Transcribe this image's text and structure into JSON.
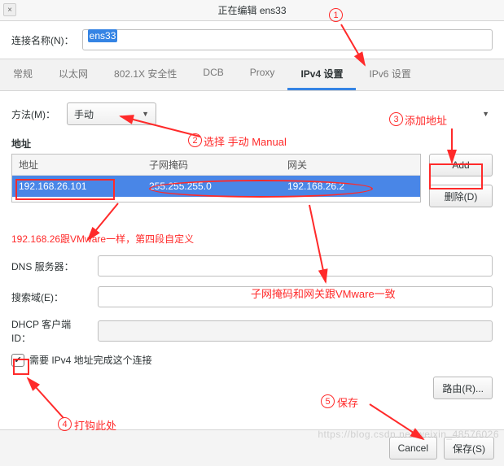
{
  "title": "正在编辑 ens33",
  "close_glyph": "×",
  "name_label": "连接名称(N)：",
  "name_value": "ens33",
  "tabs": {
    "t0": "常规",
    "t1": "以太网",
    "t2": "802.1X 安全性",
    "t3": "DCB",
    "t4": "Proxy",
    "t5": "IPv4 设置",
    "t6": "IPv6 设置"
  },
  "method_label": "方法(M)：",
  "method_value": "手动",
  "addr_label": "地址",
  "table": {
    "h1": "地址",
    "h2": "子网掩码",
    "h3": "网关",
    "row": {
      "ip": "192.168.26.101",
      "mask": "255.255.255.0",
      "gw": "192.168.26.2"
    }
  },
  "buttons": {
    "add": "Add",
    "delete": "删除(D)",
    "routes": "路由(R)...",
    "cancel": "Cancel",
    "save": "保存(S)"
  },
  "fields": {
    "dns": "DNS 服务器：",
    "search": "搜索域(E)：",
    "dhcp": "DHCP 客户端 ID："
  },
  "checkbox_label": "需要 IPv4 地址完成这个连接",
  "check_glyph": "✔",
  "watermark": "https://blog.csdn.net/weixin_48576026",
  "anno": {
    "n1": "1",
    "n2": "2",
    "n3": "3",
    "n4": "4",
    "n5": "5",
    "manual": "选择 手动 Manual",
    "add_addr": "添加地址",
    "ip_note": "192.168.26跟VMware一样，第四段自定义",
    "mask_gw": "子网掩码和网关跟VMware一致",
    "chk_note": "打钩此处",
    "save_note": "保存"
  }
}
